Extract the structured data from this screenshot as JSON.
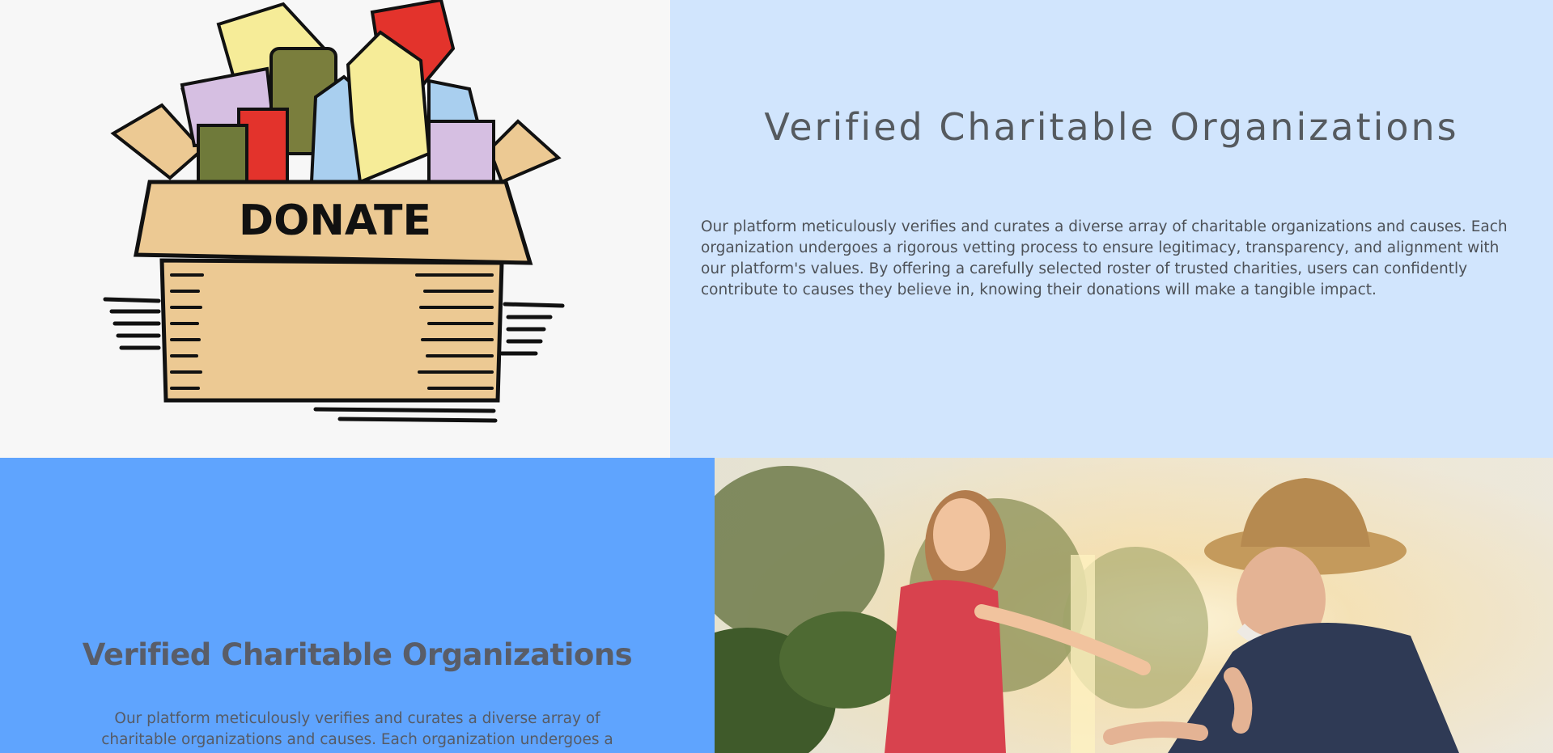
{
  "donate_image": {
    "label": "DONATE",
    "icon": "donation-box-illustration"
  },
  "intro": {
    "title": "Verified Charitable Organizations",
    "body": "Our platform meticulously verifies and curates a diverse array of charitable organizations and causes. Each organization undergoes a rigorous vetting process to ensure legitimacy, transparency, and alignment with our platform's values. By offering a carefully selected roster of trusted charities, users can confidently contribute to causes they believe in, knowing their donations will make a tangible impact."
  },
  "feature": {
    "title": "Verified Charitable Organizations",
    "body": "Our platform meticulously verifies and curates a diverse array of charitable organizations and causes. Each organization undergoes a rigorous vetting"
  },
  "photo": {
    "icon": "girl-and-elderly-man-photo"
  },
  "colors": {
    "donate_bg": "#f7f7f7",
    "intro_bg": "#d1e5fd",
    "feature_bg": "#5fa4fe",
    "heading_text": "#555a5f",
    "body_text": "#4d5157"
  }
}
